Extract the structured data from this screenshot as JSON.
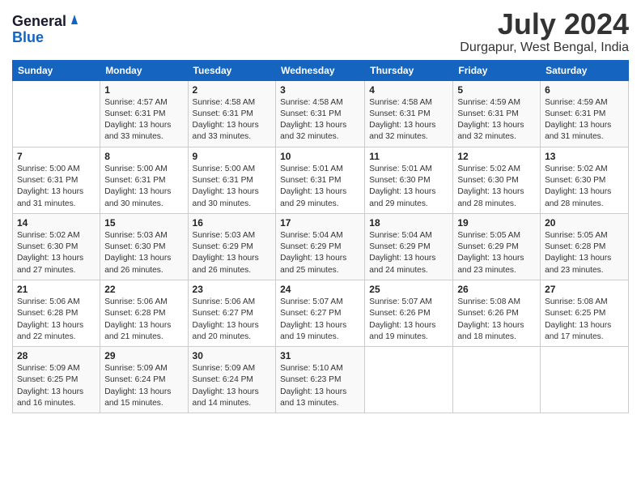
{
  "header": {
    "logo_general": "General",
    "logo_blue": "Blue",
    "month_year": "July 2024",
    "location": "Durgapur, West Bengal, India"
  },
  "days_of_week": [
    "Sunday",
    "Monday",
    "Tuesday",
    "Wednesday",
    "Thursday",
    "Friday",
    "Saturday"
  ],
  "weeks": [
    [
      {
        "day": "",
        "info": ""
      },
      {
        "day": "1",
        "info": "Sunrise: 4:57 AM\nSunset: 6:31 PM\nDaylight: 13 hours\nand 33 minutes."
      },
      {
        "day": "2",
        "info": "Sunrise: 4:58 AM\nSunset: 6:31 PM\nDaylight: 13 hours\nand 33 minutes."
      },
      {
        "day": "3",
        "info": "Sunrise: 4:58 AM\nSunset: 6:31 PM\nDaylight: 13 hours\nand 32 minutes."
      },
      {
        "day": "4",
        "info": "Sunrise: 4:58 AM\nSunset: 6:31 PM\nDaylight: 13 hours\nand 32 minutes."
      },
      {
        "day": "5",
        "info": "Sunrise: 4:59 AM\nSunset: 6:31 PM\nDaylight: 13 hours\nand 32 minutes."
      },
      {
        "day": "6",
        "info": "Sunrise: 4:59 AM\nSunset: 6:31 PM\nDaylight: 13 hours\nand 31 minutes."
      }
    ],
    [
      {
        "day": "7",
        "info": "Sunrise: 5:00 AM\nSunset: 6:31 PM\nDaylight: 13 hours\nand 31 minutes."
      },
      {
        "day": "8",
        "info": "Sunrise: 5:00 AM\nSunset: 6:31 PM\nDaylight: 13 hours\nand 30 minutes."
      },
      {
        "day": "9",
        "info": "Sunrise: 5:00 AM\nSunset: 6:31 PM\nDaylight: 13 hours\nand 30 minutes."
      },
      {
        "day": "10",
        "info": "Sunrise: 5:01 AM\nSunset: 6:31 PM\nDaylight: 13 hours\nand 29 minutes."
      },
      {
        "day": "11",
        "info": "Sunrise: 5:01 AM\nSunset: 6:30 PM\nDaylight: 13 hours\nand 29 minutes."
      },
      {
        "day": "12",
        "info": "Sunrise: 5:02 AM\nSunset: 6:30 PM\nDaylight: 13 hours\nand 28 minutes."
      },
      {
        "day": "13",
        "info": "Sunrise: 5:02 AM\nSunset: 6:30 PM\nDaylight: 13 hours\nand 28 minutes."
      }
    ],
    [
      {
        "day": "14",
        "info": "Sunrise: 5:02 AM\nSunset: 6:30 PM\nDaylight: 13 hours\nand 27 minutes."
      },
      {
        "day": "15",
        "info": "Sunrise: 5:03 AM\nSunset: 6:30 PM\nDaylight: 13 hours\nand 26 minutes."
      },
      {
        "day": "16",
        "info": "Sunrise: 5:03 AM\nSunset: 6:29 PM\nDaylight: 13 hours\nand 26 minutes."
      },
      {
        "day": "17",
        "info": "Sunrise: 5:04 AM\nSunset: 6:29 PM\nDaylight: 13 hours\nand 25 minutes."
      },
      {
        "day": "18",
        "info": "Sunrise: 5:04 AM\nSunset: 6:29 PM\nDaylight: 13 hours\nand 24 minutes."
      },
      {
        "day": "19",
        "info": "Sunrise: 5:05 AM\nSunset: 6:29 PM\nDaylight: 13 hours\nand 23 minutes."
      },
      {
        "day": "20",
        "info": "Sunrise: 5:05 AM\nSunset: 6:28 PM\nDaylight: 13 hours\nand 23 minutes."
      }
    ],
    [
      {
        "day": "21",
        "info": "Sunrise: 5:06 AM\nSunset: 6:28 PM\nDaylight: 13 hours\nand 22 minutes."
      },
      {
        "day": "22",
        "info": "Sunrise: 5:06 AM\nSunset: 6:28 PM\nDaylight: 13 hours\nand 21 minutes."
      },
      {
        "day": "23",
        "info": "Sunrise: 5:06 AM\nSunset: 6:27 PM\nDaylight: 13 hours\nand 20 minutes."
      },
      {
        "day": "24",
        "info": "Sunrise: 5:07 AM\nSunset: 6:27 PM\nDaylight: 13 hours\nand 19 minutes."
      },
      {
        "day": "25",
        "info": "Sunrise: 5:07 AM\nSunset: 6:26 PM\nDaylight: 13 hours\nand 19 minutes."
      },
      {
        "day": "26",
        "info": "Sunrise: 5:08 AM\nSunset: 6:26 PM\nDaylight: 13 hours\nand 18 minutes."
      },
      {
        "day": "27",
        "info": "Sunrise: 5:08 AM\nSunset: 6:25 PM\nDaylight: 13 hours\nand 17 minutes."
      }
    ],
    [
      {
        "day": "28",
        "info": "Sunrise: 5:09 AM\nSunset: 6:25 PM\nDaylight: 13 hours\nand 16 minutes."
      },
      {
        "day": "29",
        "info": "Sunrise: 5:09 AM\nSunset: 6:24 PM\nDaylight: 13 hours\nand 15 minutes."
      },
      {
        "day": "30",
        "info": "Sunrise: 5:09 AM\nSunset: 6:24 PM\nDaylight: 13 hours\nand 14 minutes."
      },
      {
        "day": "31",
        "info": "Sunrise: 5:10 AM\nSunset: 6:23 PM\nDaylight: 13 hours\nand 13 minutes."
      },
      {
        "day": "",
        "info": ""
      },
      {
        "day": "",
        "info": ""
      },
      {
        "day": "",
        "info": ""
      }
    ]
  ]
}
